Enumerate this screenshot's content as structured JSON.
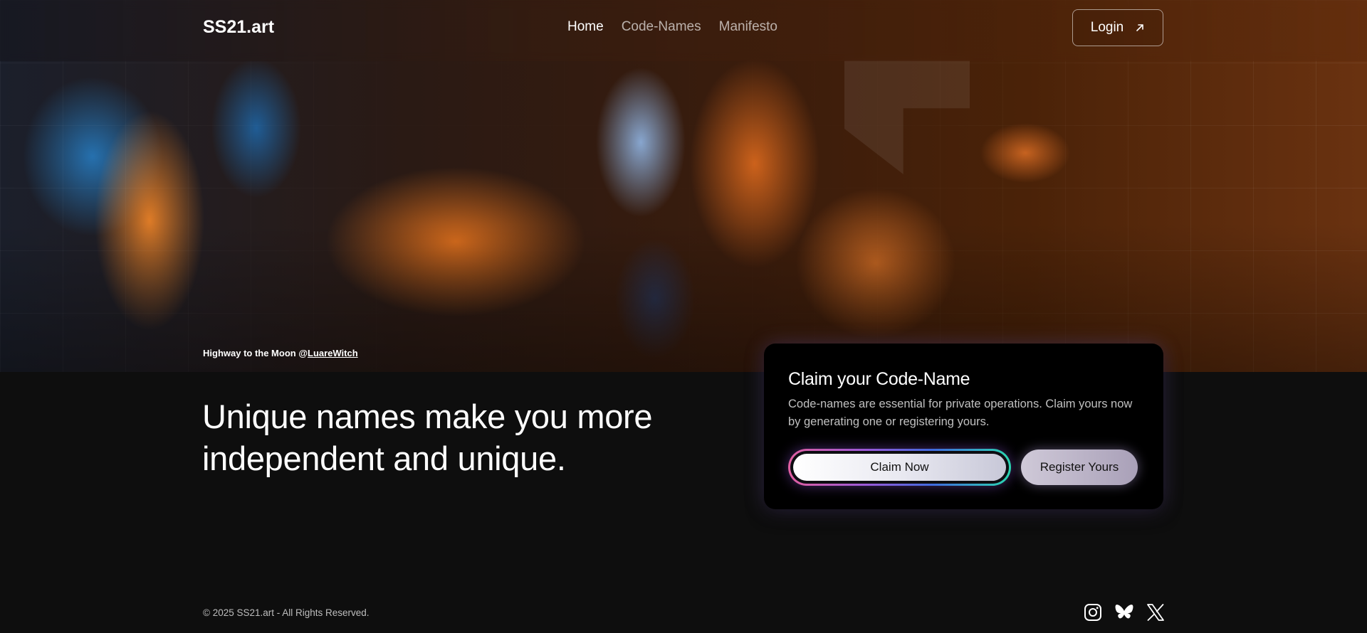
{
  "nav": {
    "brand": "SS21.art",
    "links": [
      {
        "label": "Home",
        "active": true
      },
      {
        "label": "Code-Names",
        "active": false
      },
      {
        "label": "Manifesto",
        "active": false
      }
    ],
    "login_label": "Login",
    "login_icon": "arrow-up-right-icon"
  },
  "hero": {
    "caption_title": "Highway to the Moon @",
    "caption_credit": "LuareWitch"
  },
  "main": {
    "headline": "Unique names make you more independent and unique."
  },
  "card": {
    "title": "Claim your Code-Name",
    "description": "Code-names are essential for private operations. Claim yours now by generating one or registering yours.",
    "claim_label": "Claim Now",
    "register_label": "Register Yours"
  },
  "footer": {
    "copyright": "© 2025 SS21.art - All Rights Reserved.",
    "socials": [
      "instagram-icon",
      "bluesky-icon",
      "x-icon"
    ]
  },
  "colors": {
    "background": "#0e0e0e",
    "card": "#000000",
    "claim_gradient": [
      "#e15fa0",
      "#9b59d9",
      "#3f6be0",
      "#2bd6b0"
    ]
  }
}
